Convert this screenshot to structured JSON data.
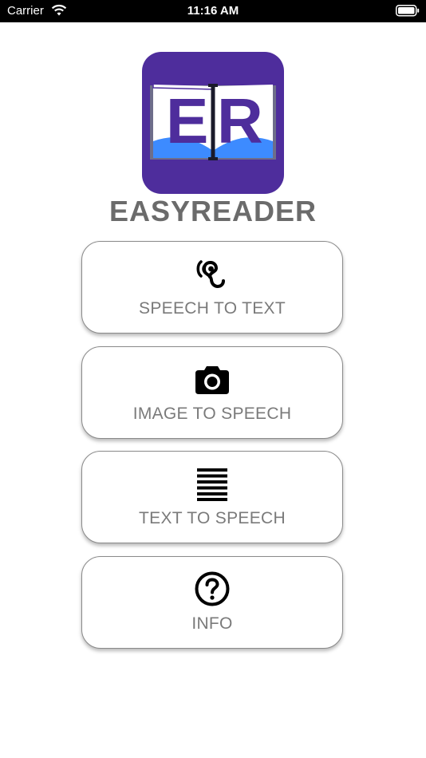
{
  "status_bar": {
    "carrier": "Carrier",
    "time": "11:16 AM"
  },
  "app": {
    "logo_text": "ER",
    "title": "EASYREADER",
    "logo_color": "#4e2d9c",
    "logo_accent": "#3d8bff"
  },
  "menu": [
    {
      "label": "SPEECH TO TEXT",
      "icon": "ear-icon"
    },
    {
      "label": "IMAGE TO SPEECH",
      "icon": "camera-icon"
    },
    {
      "label": "TEXT TO SPEECH",
      "icon": "text-lines-icon"
    },
    {
      "label": "INFO",
      "icon": "question-circle-icon"
    }
  ]
}
